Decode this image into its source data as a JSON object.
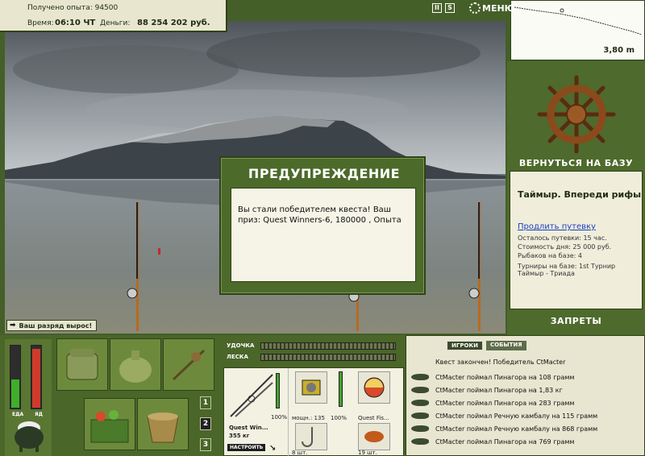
{
  "top_info": {
    "exp_label": "Получено опыта: 94500",
    "time_label": "Время:",
    "time_value": "06:10 ЧТ",
    "money_label": "Деньги:",
    "money_value": "88 254 202 руб."
  },
  "top_icons": {
    "pause": "II",
    "sound": "S",
    "menu_label": "МЕНЮ"
  },
  "depth": {
    "value": "3,80 m"
  },
  "right_panel": {
    "back_to_base": "ВЕРНУТЬСЯ НА БАЗУ",
    "location_title": "Таймыр. Впереди рифы",
    "extend_trip": "Продлить путевку",
    "lines": [
      "Осталось путевки: 15 час.",
      "Стоимость дня: 25 000 руб.",
      "Рыбаков на базе: 4",
      "Турниры на базе: 1st Турнир Таймыр - Триада"
    ],
    "bans": "ЗАПРЕТЫ"
  },
  "dialog": {
    "title": "ПРЕДУПРЕЖДЕНИЕ",
    "body": "Вы стали победителем квеста! Ваш приз: Quest Winners-6, 180000 , Опыта"
  },
  "rank_toast": "Ваш разряд вырос!",
  "status_bars": {
    "food_label": "ЕДА",
    "poison_label": "ЯД",
    "food_level": 0.45,
    "poison_level": 0.93
  },
  "inventory_pages": [
    "1",
    "2",
    "3"
  ],
  "tackle": {
    "rod_label": "УДОЧКА",
    "line_label": "ЛЕСКА",
    "rod_name": "Quest Win...",
    "rod_weight": "355 кг",
    "rod_pct": "100%",
    "adjust_button": "НАСТРОИТЬ",
    "reel_label": "мощн.: 135",
    "reel_pct": "100%",
    "bait_label": "Quest Fis...",
    "hook_count": "8 шт.",
    "lure_count": "19 шт."
  },
  "chat": {
    "tabs": [
      "ИГРОКИ",
      "СОБЫТИЯ"
    ],
    "active_tab": "ИГРОКИ",
    "first_line": "Квест закончен! Победитель CtMacter",
    "messages": [
      "CtMacter поймал Пинагора на 108 грамм",
      "CtMacter поймал Пинагора на 1,83 кг",
      "CtMacter поймал Пинагора на 283 грамм",
      "CtMacter поймал Речную камбалу на 115 грамм",
      "CtMacter поймал Речную камбалу на 868 грамм",
      "CtMacter поймал Пинагора на 769 грамм"
    ]
  }
}
